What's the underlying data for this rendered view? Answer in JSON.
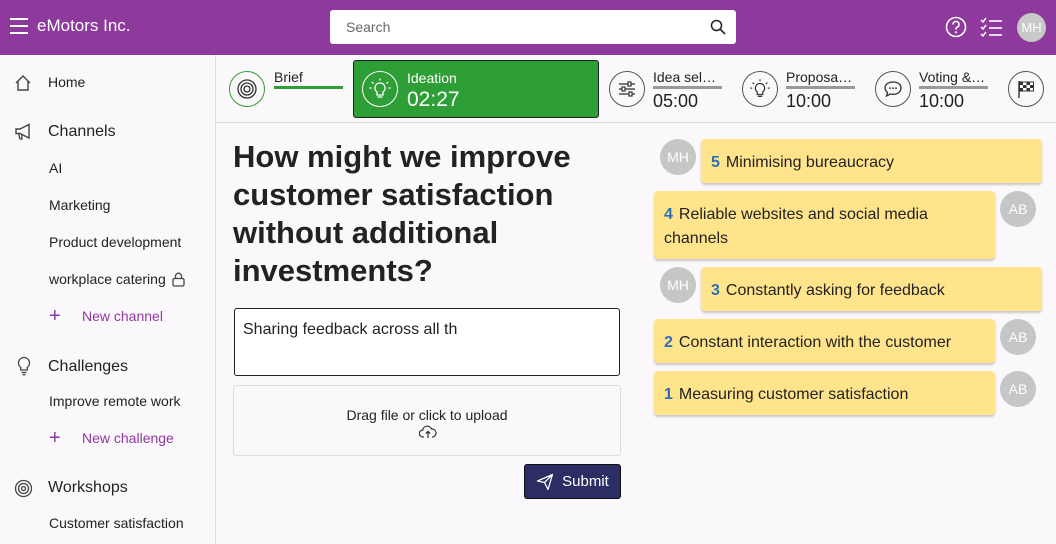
{
  "header": {
    "app_title": "eMotors Inc.",
    "search_placeholder": "Search",
    "user_initials": "MH"
  },
  "sidebar": {
    "home": "Home",
    "channels_title": "Channels",
    "channels": [
      "AI",
      "Marketing",
      "Product development",
      "workplace catering"
    ],
    "new_channel": "New channel",
    "challenges_title": "Challenges",
    "challenges": [
      "Improve remote work"
    ],
    "new_challenge": "New challenge",
    "workshops_title": "Workshops",
    "workshops": [
      "Customer satisfaction"
    ]
  },
  "phases": {
    "brief": {
      "name": "Brief"
    },
    "ideation": {
      "name": "Ideation",
      "time": "02:27"
    },
    "idea_selection": {
      "name": "Idea sel…",
      "time": "05:00"
    },
    "proposal": {
      "name": "Proposa…",
      "time": "10:00"
    },
    "voting": {
      "name": "Voting &…",
      "time": "10:00"
    }
  },
  "main": {
    "question": "How might we improve customer satisfaction without additional investments?",
    "answer_value": "Sharing feedback across all th",
    "upload_label": "Drag file or click to upload",
    "submit_label": "Submit"
  },
  "ideas": [
    {
      "num": "5",
      "text": "Minimising bureaucracy",
      "author": "MH"
    },
    {
      "num": "4",
      "text": "Reliable websites and social media channels",
      "author": "AB"
    },
    {
      "num": "3",
      "text": "Constantly asking for feedback",
      "author": "MH"
    },
    {
      "num": "2",
      "text": "Constant interaction with the customer",
      "author": "AB"
    },
    {
      "num": "1",
      "text": "Measuring customer satisfaction",
      "author": "AB"
    }
  ],
  "colors": {
    "header": "#8e3a9c",
    "active_phase": "#2e9e36",
    "submit": "#2b2d64",
    "idea_card": "#ffe48c",
    "idea_number": "#2a6fb8"
  }
}
